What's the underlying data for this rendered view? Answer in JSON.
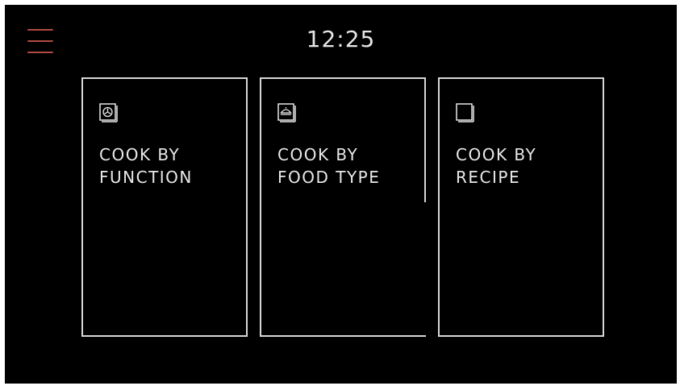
{
  "header": {
    "time": "12:25",
    "menu_icon": "hamburger-menu-icon"
  },
  "colors": {
    "background": "#000000",
    "menu_accent": "#b14a42",
    "card_border": "#d7d7d7",
    "text": "#e8e8e8"
  },
  "cards": [
    {
      "line1": "COOK BY",
      "line2": "FUNCTION",
      "icon": "oven-fan-icon"
    },
    {
      "line1": "COOK BY",
      "line2": "FOOD TYPE",
      "icon": "food-dish-icon"
    },
    {
      "line1": "COOK BY",
      "line2": "RECIPE",
      "icon": "recipe-book-icon"
    }
  ]
}
